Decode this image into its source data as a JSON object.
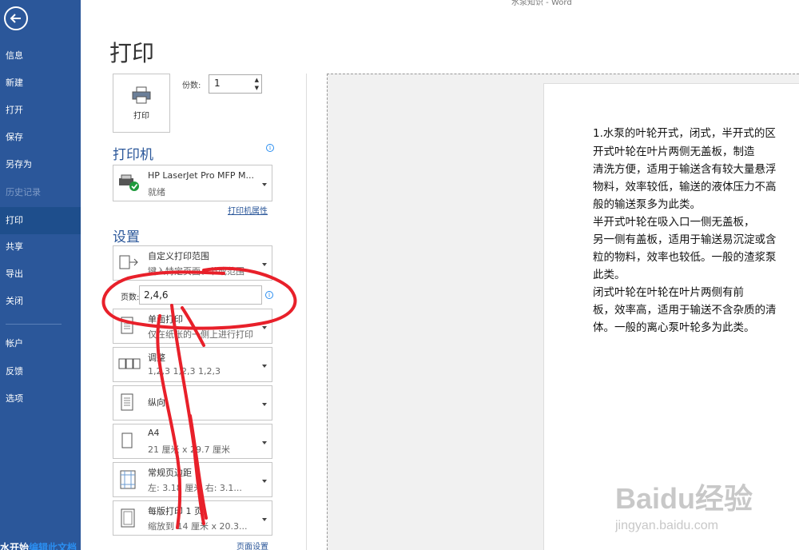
{
  "window": {
    "title": "水泵知识 - Word"
  },
  "sidebar": {
    "items": [
      {
        "label": "信息"
      },
      {
        "label": "新建"
      },
      {
        "label": "打开"
      },
      {
        "label": "保存"
      },
      {
        "label": "另存为"
      },
      {
        "label": "历史记录"
      },
      {
        "label": "打印"
      },
      {
        "label": "共享"
      },
      {
        "label": "导出"
      },
      {
        "label": "关闭"
      },
      {
        "label": "帐户"
      },
      {
        "label": "反馈"
      },
      {
        "label": "选项"
      }
    ],
    "active_index": 6,
    "footer_text": "水开始",
    "footer_link": "编辑此文档"
  },
  "print": {
    "title": "打印",
    "button_label": "打印",
    "copies_label": "份数:",
    "copies_value": "1"
  },
  "printer": {
    "section_title": "打印机",
    "name": "HP LaserJet Pro MFP M...",
    "status": "就绪",
    "properties_link": "打印机属性"
  },
  "settings": {
    "section_title": "设置",
    "range_main": "自定义打印范围",
    "range_sub": "键入特定页面、节或范围",
    "pages_label": "页数:",
    "pages_value": "2,4,6",
    "sides_main": "单面打印",
    "sides_sub": "仅在纸张的一侧上进行打印",
    "collate_main": "调整",
    "collate_sub": "1,2,3    1,2,3    1,2,3",
    "orientation_main": "纵向",
    "paper_main": "A4",
    "paper_sub": "21 厘米 x 29.7 厘米",
    "margins_main": "常规页边距",
    "margins_sub": "左: 3.18 厘米    右: 3.1...",
    "persheet_main": "每版打印 1 页",
    "persheet_sub": "缩放到 14 厘米 x 20.3...",
    "page_setup_link": "页面设置"
  },
  "document": {
    "lines": [
      "1.水泵的叶轮开式，闭式，半开式的区",
      "    开式叶轮在叶片两侧无盖板，制造",
      "清洗方便，适用于输送含有较大量悬浮",
      "物料，效率较低，输送的液体压力不高",
      "般的输送泵多为此类。",
      "    半开式叶轮在吸入口一侧无盖板，",
      "另一侧有盖板，适用于输送易沉淀或含",
      "粒的物料，效率也较低。一般的渣浆泵",
      "此类。",
      "    闭式叶轮在叶轮在叶片两侧有前",
      "板，效率高，适用于输送不含杂质的清",
      "体。一般的离心泵叶轮多为此类。"
    ]
  },
  "watermark": {
    "brand": "Baidu经验",
    "url": "jingyan.baidu.com"
  },
  "colors": {
    "sidebar": "#2b579a",
    "active": "#1e4e8c",
    "annotation": "#e8202a"
  }
}
